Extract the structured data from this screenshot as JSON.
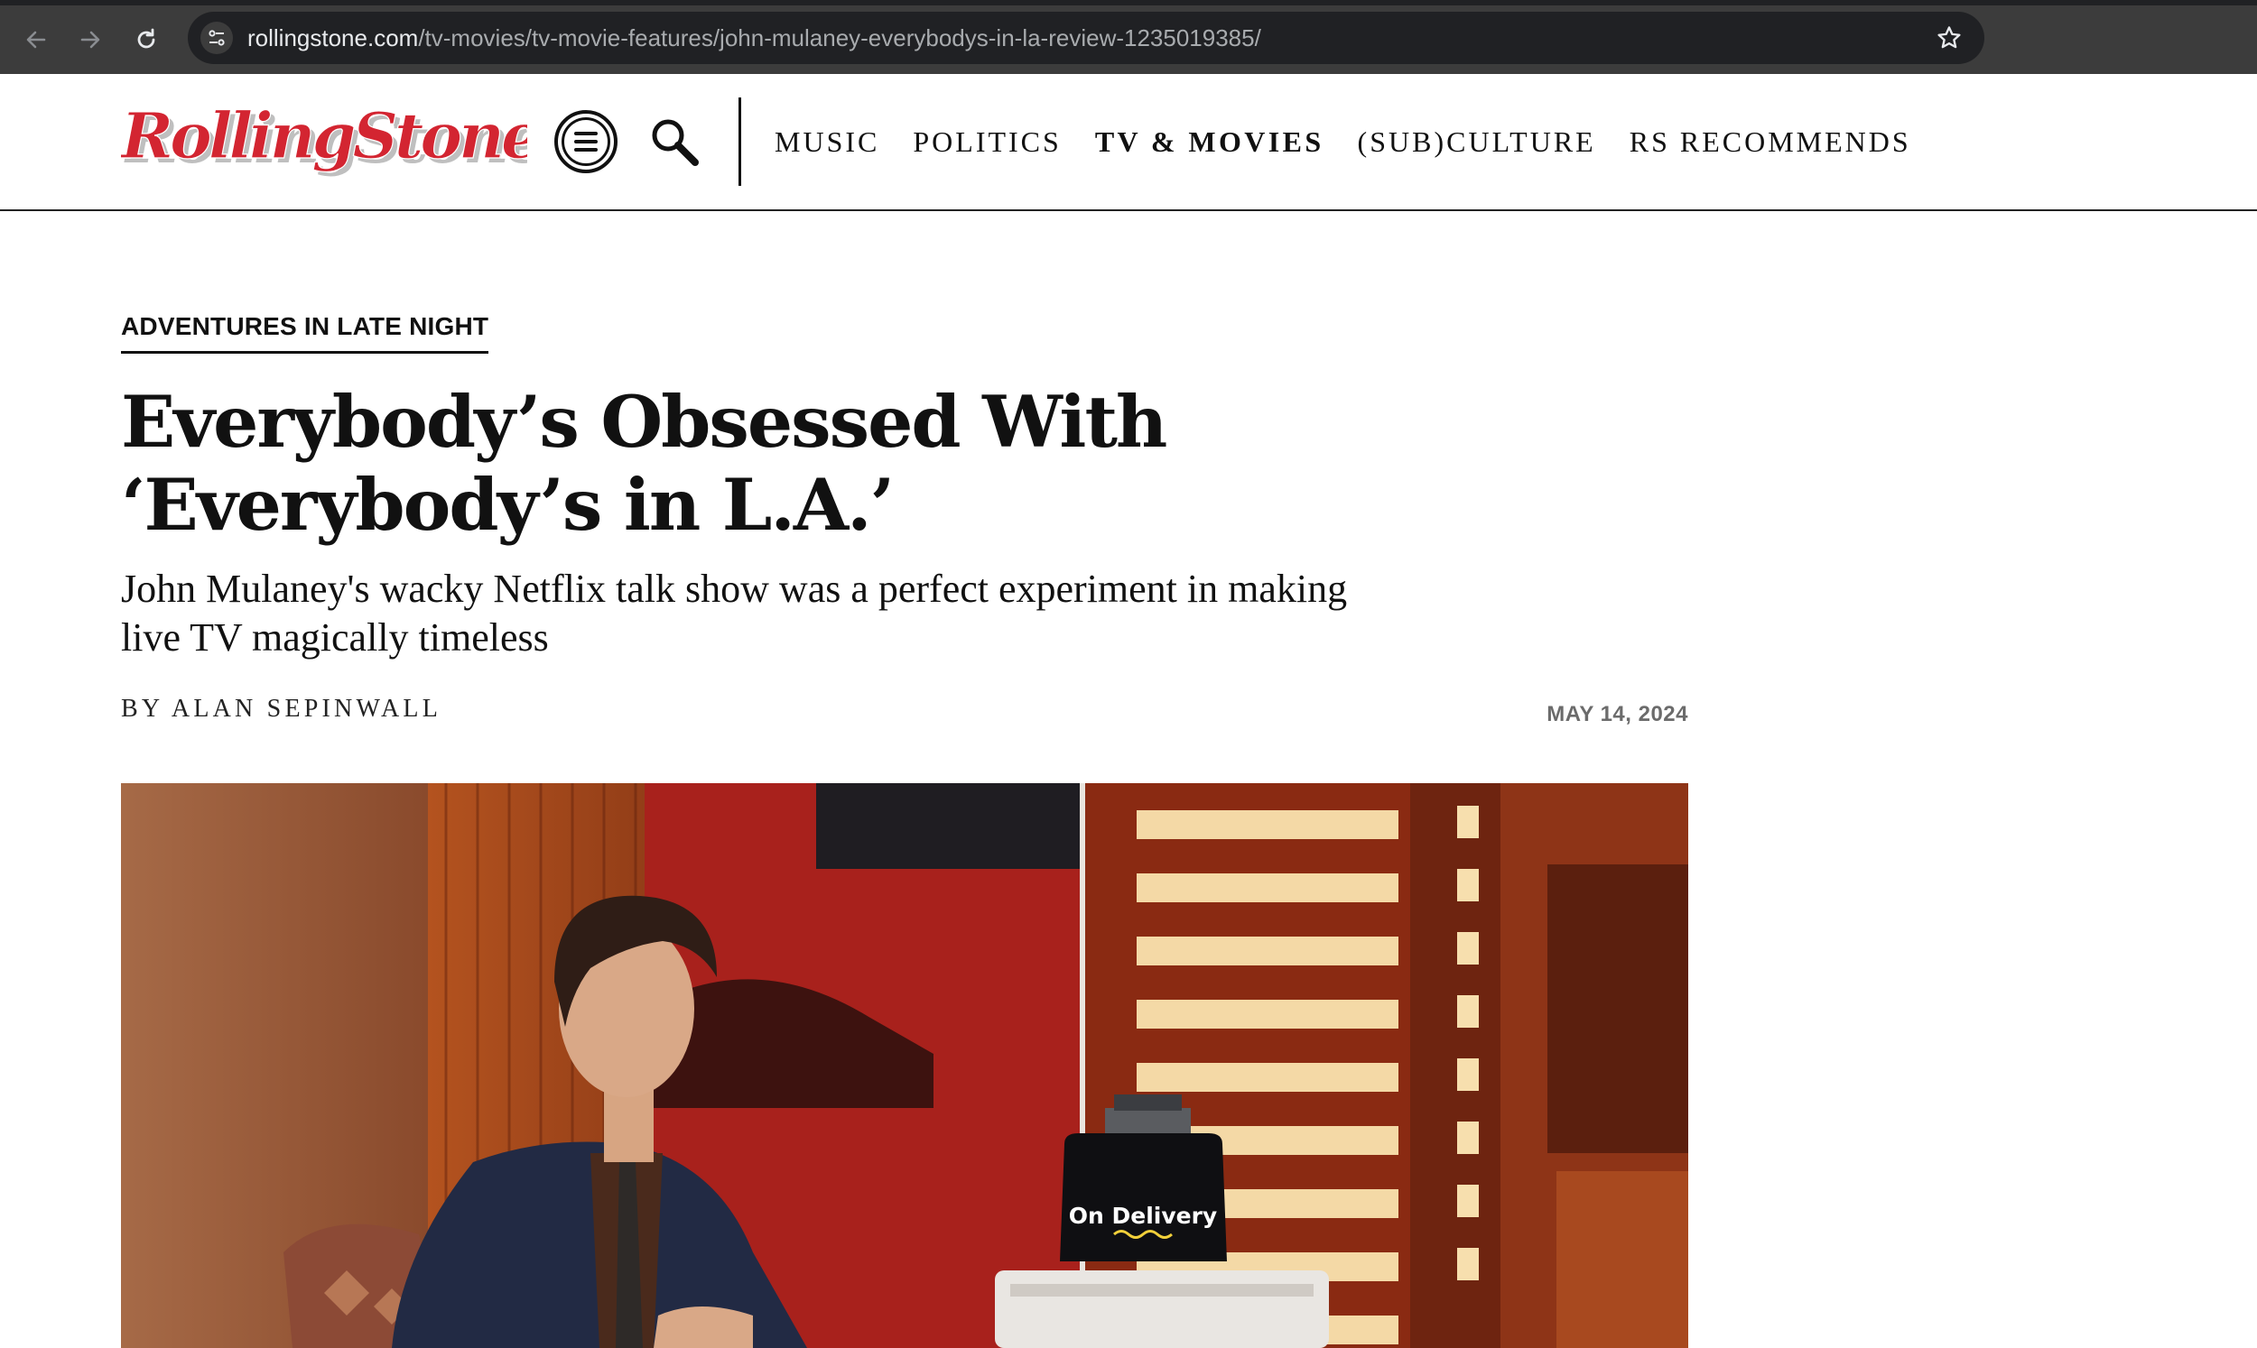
{
  "browser": {
    "url_domain": "rollingstone.com",
    "url_path": "/tv-movies/tv-movie-features/john-mulaney-everybodys-in-la-review-1235019385/"
  },
  "site": {
    "logo_text": "RollingStone",
    "nav": [
      {
        "label": "MUSIC"
      },
      {
        "label": "POLITICS"
      },
      {
        "label": "TV & MOVIES",
        "active": true
      },
      {
        "label": "(SUB)CULTURE"
      },
      {
        "label": "RS RECOMMENDS"
      }
    ]
  },
  "article": {
    "kicker": "ADVENTURES IN LATE NIGHT",
    "headline": "Everybody’s Obsessed With ‘Everybody’s in L.A.’",
    "dek": "John Mulaney's wacky Netflix talk show was a perfect experiment in making live TV magically timeless",
    "byline": "BY ALAN SEPINWALL",
    "date": "MAY 14, 2024"
  },
  "hero": {
    "screen_text": "On Delivery"
  },
  "colors": {
    "brand_red": "#d32531",
    "chrome_bg": "#3c3c3c",
    "omnibox_bg": "#202124"
  }
}
